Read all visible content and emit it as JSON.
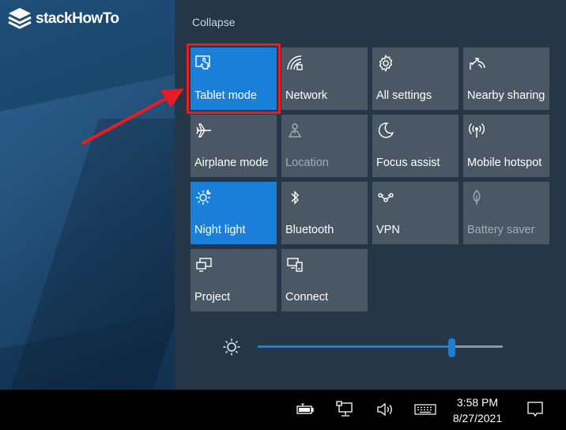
{
  "watermark": {
    "text": "stackHowTo",
    "icon": "layers-logo-icon"
  },
  "action_center": {
    "collapse_label": "Collapse",
    "tiles": [
      {
        "label": "Tablet mode",
        "icon": "tablet-mode-icon",
        "state": "on"
      },
      {
        "label": "Network",
        "icon": "network-icon",
        "state": "off"
      },
      {
        "label": "All settings",
        "icon": "gear-icon",
        "state": "off"
      },
      {
        "label": "Nearby sharing",
        "icon": "nearby-sharing-icon",
        "state": "off"
      },
      {
        "label": "Airplane mode",
        "icon": "airplane-icon",
        "state": "off"
      },
      {
        "label": "Location",
        "icon": "location-icon",
        "state": "disabled"
      },
      {
        "label": "Focus assist",
        "icon": "moon-icon",
        "state": "off"
      },
      {
        "label": "Mobile hotspot",
        "icon": "hotspot-icon",
        "state": "off"
      },
      {
        "label": "Night light",
        "icon": "night-light-icon",
        "state": "on"
      },
      {
        "label": "Bluetooth",
        "icon": "bluetooth-icon",
        "state": "off"
      },
      {
        "label": "VPN",
        "icon": "vpn-icon",
        "state": "off"
      },
      {
        "label": "Battery saver",
        "icon": "battery-saver-icon",
        "state": "disabled"
      },
      {
        "label": "Project",
        "icon": "project-icon",
        "state": "off"
      },
      {
        "label": "Connect",
        "icon": "connect-icon",
        "state": "off"
      }
    ],
    "brightness": {
      "icon": "brightness-icon",
      "level": 0.79
    }
  },
  "taskbar": {
    "tray_icons": [
      "battery-icon",
      "network-display-icon",
      "volume-icon",
      "keyboard-icon"
    ],
    "time": "3:58 PM",
    "date": "8/27/2021",
    "notification_icon": "notification-icon"
  },
  "colors": {
    "accent": "#1a7fd9",
    "panel": "#253646",
    "tile": "#4a5866",
    "highlight": "#e81c24",
    "arrow": "#e81c24"
  }
}
